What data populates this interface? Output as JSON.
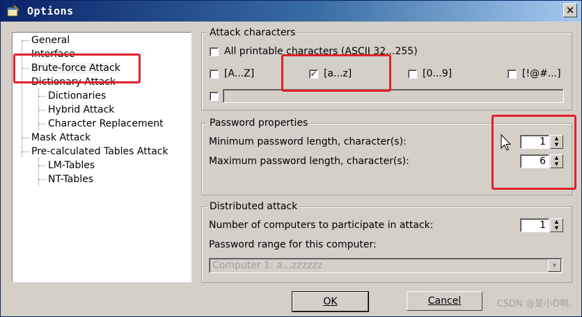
{
  "window": {
    "title": "Options",
    "close_glyph": "✕"
  },
  "tree": {
    "items": [
      {
        "label": "General",
        "level": 0
      },
      {
        "label": "Interface",
        "level": 0
      },
      {
        "label": "Brute-force Attack",
        "level": 0,
        "selected": true
      },
      {
        "label": "Dictionary Attack",
        "level": 0
      },
      {
        "label": "Dictionaries",
        "level": 1
      },
      {
        "label": "Hybrid Attack",
        "level": 1
      },
      {
        "label": "Character Replacement",
        "level": 1
      },
      {
        "label": "Mask Attack",
        "level": 0
      },
      {
        "label": "Pre-calculated Tables Attack",
        "level": 0
      },
      {
        "label": "LM-Tables",
        "level": 1
      },
      {
        "label": "NT-Tables",
        "level": 1
      }
    ]
  },
  "attack_characters": {
    "group_label": "Attack characters",
    "all_printable": {
      "label": "All printable characters (ASCII 32...255)",
      "checked": false
    },
    "upper": {
      "label": "[A...Z]",
      "checked": false
    },
    "lower": {
      "label": "[a...z]",
      "checked": true
    },
    "digits": {
      "label": "[0...9]",
      "checked": false
    },
    "symbols": {
      "label": "[!@#...]",
      "checked": false
    },
    "custom": {
      "checked": false,
      "value": ""
    }
  },
  "password_properties": {
    "group_label": "Password properties",
    "min_label": "Minimum password length, character(s):",
    "min_value": "1",
    "max_label": "Maximum password length, character(s):",
    "max_value": "6"
  },
  "distributed": {
    "group_label": "Distributed attack",
    "computers_label": "Number of computers to participate in attack:",
    "computers_value": "1",
    "range_label": "Password range for this computer:",
    "range_value": "Computer 1: a...zzzzzz"
  },
  "buttons": {
    "ok": "OK",
    "cancel": "Cancel"
  },
  "check_glyph": "✓",
  "spin_up": "▲",
  "spin_down": "▼",
  "combo_arrow": "▼",
  "watermark": "CSDN @是小D啊.",
  "colors": {
    "titlebar_start": "#0a246a",
    "dialog_bg": "#d4d0c8",
    "highlight_red": "#e0202a"
  }
}
